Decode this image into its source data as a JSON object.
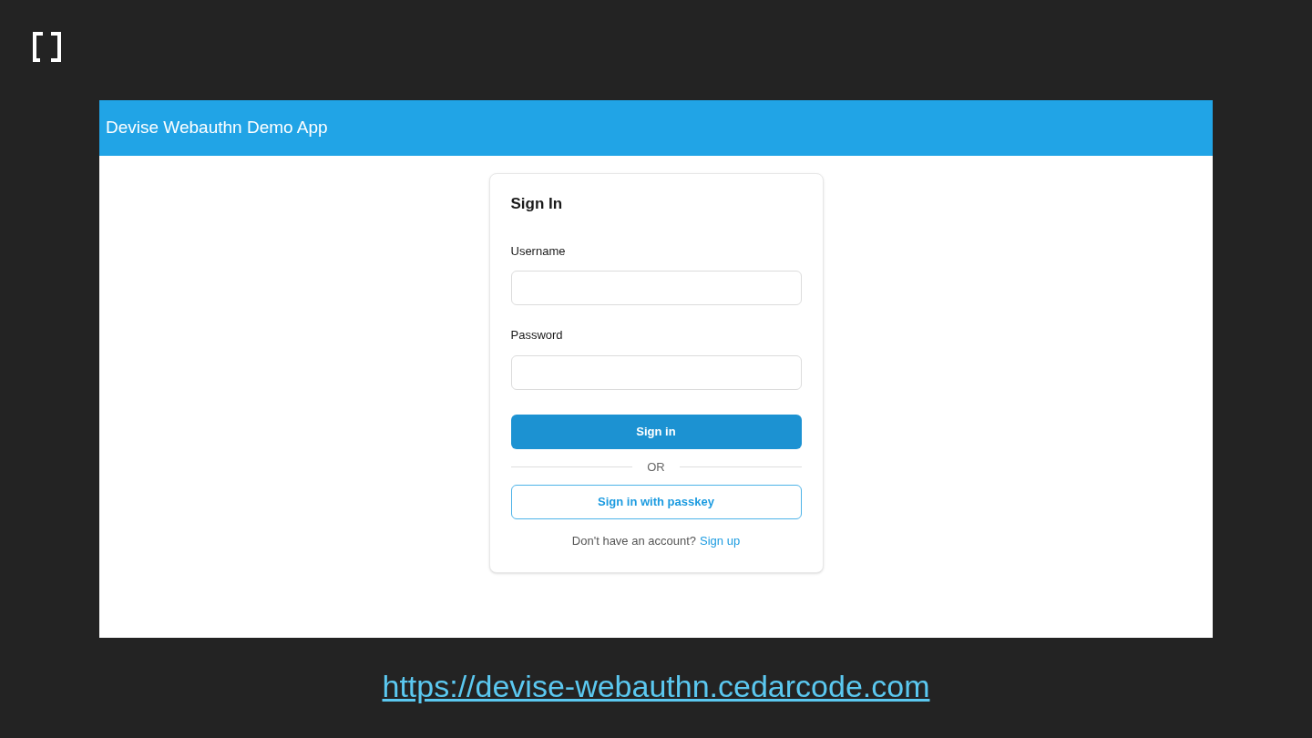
{
  "app": {
    "title": "Devise Webauthn Demo App"
  },
  "form": {
    "title": "Sign In",
    "fields": [
      {
        "label": "Username"
      },
      {
        "label": "Password"
      }
    ],
    "submit": "Sign in",
    "divider": "OR",
    "passkey_button": "Sign in with passkey",
    "signup_prompt": "Don't have an account?",
    "signup_link": "Sign up"
  },
  "footer_link": "https://devise-webauthn.cedarcode.com"
}
